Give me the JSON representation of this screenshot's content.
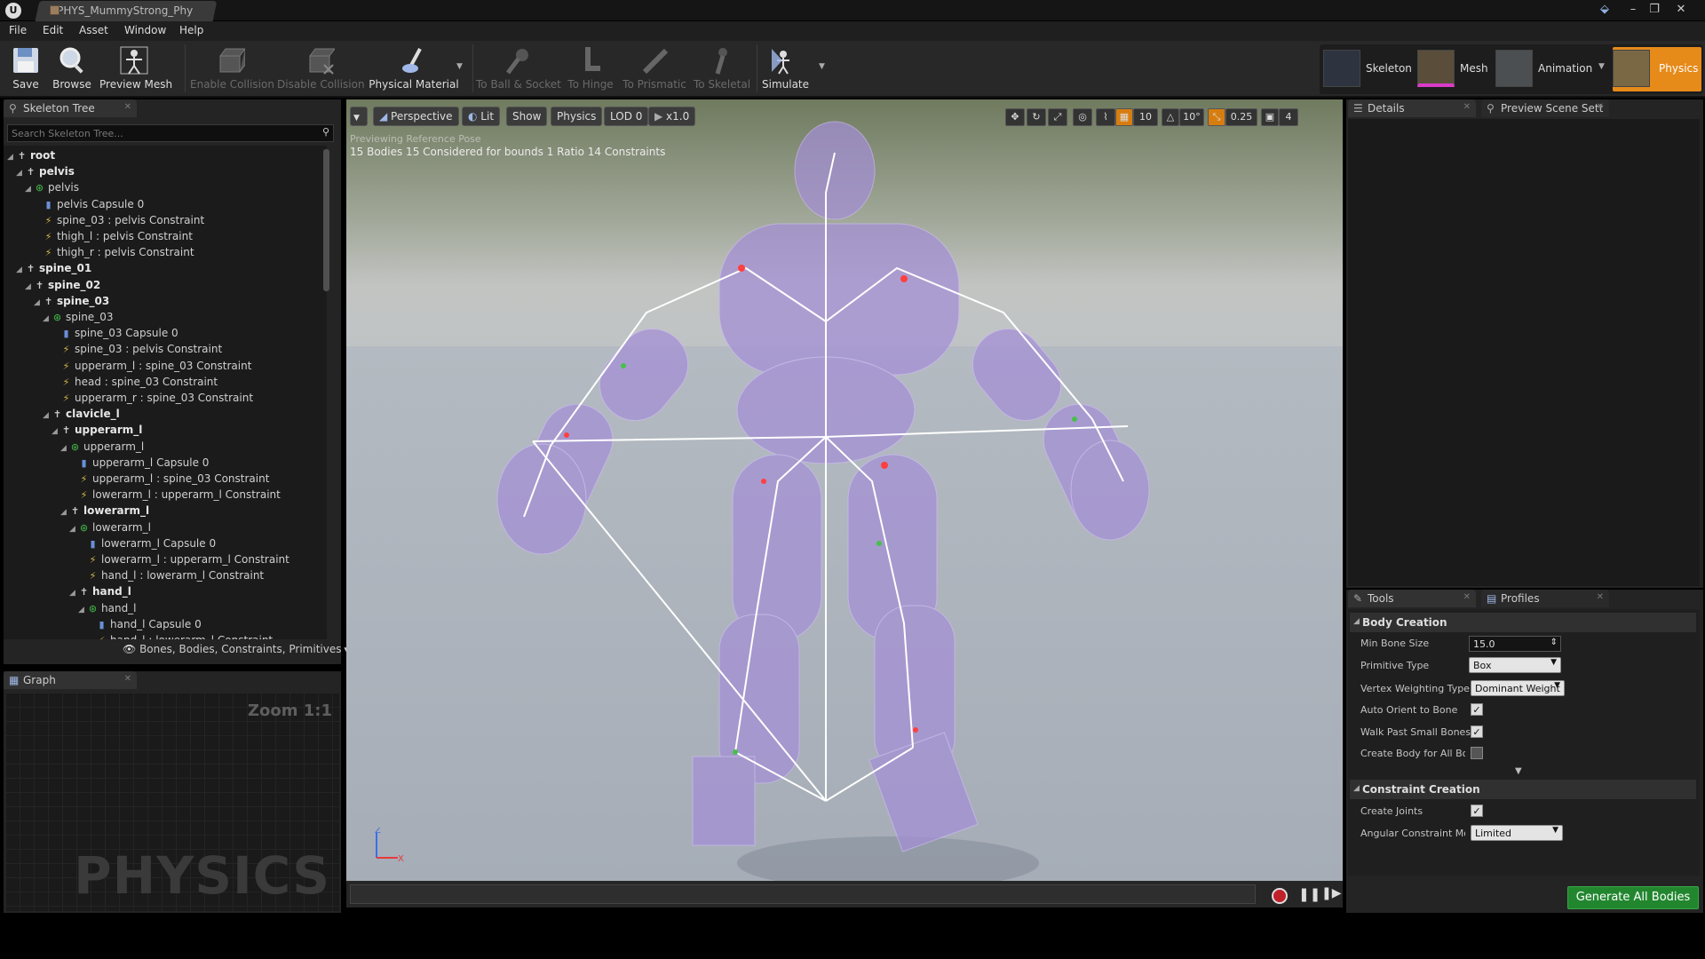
{
  "titlebar": {
    "document_tab": "PHYS_MummyStrong_Phy",
    "win_buttons": [
      "–",
      "❐",
      "✕"
    ]
  },
  "menu": [
    "File",
    "Edit",
    "Asset",
    "Window",
    "Help"
  ],
  "toolbar": {
    "save": "Save",
    "browse": "Browse",
    "preview_mesh": "Preview Mesh",
    "enable_collision": "Enable Collision",
    "disable_collision": "Disable Collision",
    "physical_material": "Physical Material",
    "to_ball_socket": "To Ball & Socket",
    "to_hinge": "To Hinge",
    "to_prismatic": "To Prismatic",
    "to_skeletal": "To Skeletal",
    "simulate": "Simulate"
  },
  "modes": [
    "Skeleton",
    "Mesh",
    "Animation",
    "Physics"
  ],
  "skeleton_tree": {
    "tab": "Skeleton Tree",
    "search_placeholder": "Search Skeleton Tree...",
    "filter": "Bones, Bodies, Constraints, Primitives",
    "rows": [
      {
        "label": "root",
        "kind": "bone"
      },
      {
        "label": "pelvis",
        "kind": "bone"
      },
      {
        "label": "pelvis",
        "kind": "body"
      },
      {
        "label": "pelvis Capsule 0",
        "kind": "cap"
      },
      {
        "label": "spine_03 : pelvis Constraint",
        "kind": "con"
      },
      {
        "label": "thigh_l : pelvis Constraint",
        "kind": "con"
      },
      {
        "label": "thigh_r : pelvis Constraint",
        "kind": "con"
      },
      {
        "label": "spine_01",
        "kind": "bone"
      },
      {
        "label": "spine_02",
        "kind": "bone"
      },
      {
        "label": "spine_03",
        "kind": "bone"
      },
      {
        "label": "spine_03",
        "kind": "body"
      },
      {
        "label": "spine_03 Capsule 0",
        "kind": "cap"
      },
      {
        "label": "spine_03 : pelvis Constraint",
        "kind": "con"
      },
      {
        "label": "upperarm_l : spine_03 Constraint",
        "kind": "con"
      },
      {
        "label": "head : spine_03 Constraint",
        "kind": "con"
      },
      {
        "label": "upperarm_r : spine_03 Constraint",
        "kind": "con"
      },
      {
        "label": "clavicle_l",
        "kind": "bone"
      },
      {
        "label": "upperarm_l",
        "kind": "bone"
      },
      {
        "label": "upperarm_l",
        "kind": "body"
      },
      {
        "label": "upperarm_l Capsule 0",
        "kind": "cap"
      },
      {
        "label": "upperarm_l : spine_03 Constraint",
        "kind": "con"
      },
      {
        "label": "lowerarm_l : upperarm_l Constraint",
        "kind": "con"
      },
      {
        "label": "lowerarm_l",
        "kind": "bone"
      },
      {
        "label": "lowerarm_l",
        "kind": "body"
      },
      {
        "label": "lowerarm_l Capsule 0",
        "kind": "cap"
      },
      {
        "label": "lowerarm_l : upperarm_l Constraint",
        "kind": "con"
      },
      {
        "label": "hand_l : lowerarm_l Constraint",
        "kind": "con"
      },
      {
        "label": "hand_l",
        "kind": "bone"
      },
      {
        "label": "hand_l",
        "kind": "body"
      },
      {
        "label": "hand_l Capsule 0",
        "kind": "cap"
      },
      {
        "label": "hand_l : lowerarm_l Constraint",
        "kind": "con"
      }
    ]
  },
  "graph": {
    "tab": "Graph",
    "zoom": "Zoom 1:1",
    "watermark": "PHYSICS"
  },
  "viewport": {
    "perspective": "Perspective",
    "lit": "Lit",
    "show": "Show",
    "physics": "Physics",
    "lod": "LOD 0",
    "speed": "x1.0",
    "grid_snap": "10",
    "rot_snap": "10°",
    "scale_snap": "0.25",
    "cam_speed": "4",
    "info_line1": "Previewing Reference Pose",
    "info_line2": "15 Bodies  15 Considered for bounds  1 Ratio  14 Constraints",
    "axis_z": "Z",
    "axis_x": "X"
  },
  "details": {
    "tab1": "Details",
    "tab2": "Preview Scene Sett"
  },
  "tools": {
    "tab1": "Tools",
    "tab2": "Profiles",
    "body_creation": "Body Creation",
    "min_bone_size_label": "Min Bone Size",
    "min_bone_size": "15.0",
    "primitive_type_label": "Primitive Type",
    "primitive_type": "Box",
    "vertex_weighting_label": "Vertex Weighting Type",
    "vertex_weighting": "Dominant Weight",
    "auto_orient_label": "Auto Orient to Bone",
    "walk_past_label": "Walk Past Small Bones",
    "create_body_all_label": "Create Body for All Bon",
    "constraint_creation": "Constraint Creation",
    "create_joints_label": "Create Joints",
    "angular_mode_label": "Angular Constraint Mod",
    "angular_mode": "Limited",
    "generate": "Generate All Bodies"
  },
  "colors": {
    "accent": "#e68a1a",
    "generate": "#22862f",
    "body": "#46c04a",
    "constraint": "#d6b84a"
  }
}
